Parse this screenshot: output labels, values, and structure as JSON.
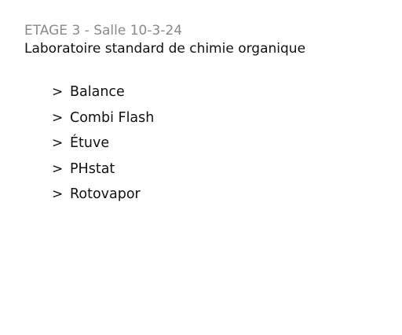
{
  "header": {
    "floor_label": "ETAGE 3 - Salle 10-3-24",
    "lab_title": "Laboratoire standard de chimie organique"
  },
  "equipment": {
    "chevron_glyph": ">",
    "items": [
      {
        "label": "Balance"
      },
      {
        "label": "Combi Flash"
      },
      {
        "label": "Étuve"
      },
      {
        "label": "PHstat"
      },
      {
        "label": "Rotovapor"
      }
    ]
  },
  "colors": {
    "floor_label": "#8a8a8a",
    "text": "#111111",
    "background": "#ffffff"
  }
}
